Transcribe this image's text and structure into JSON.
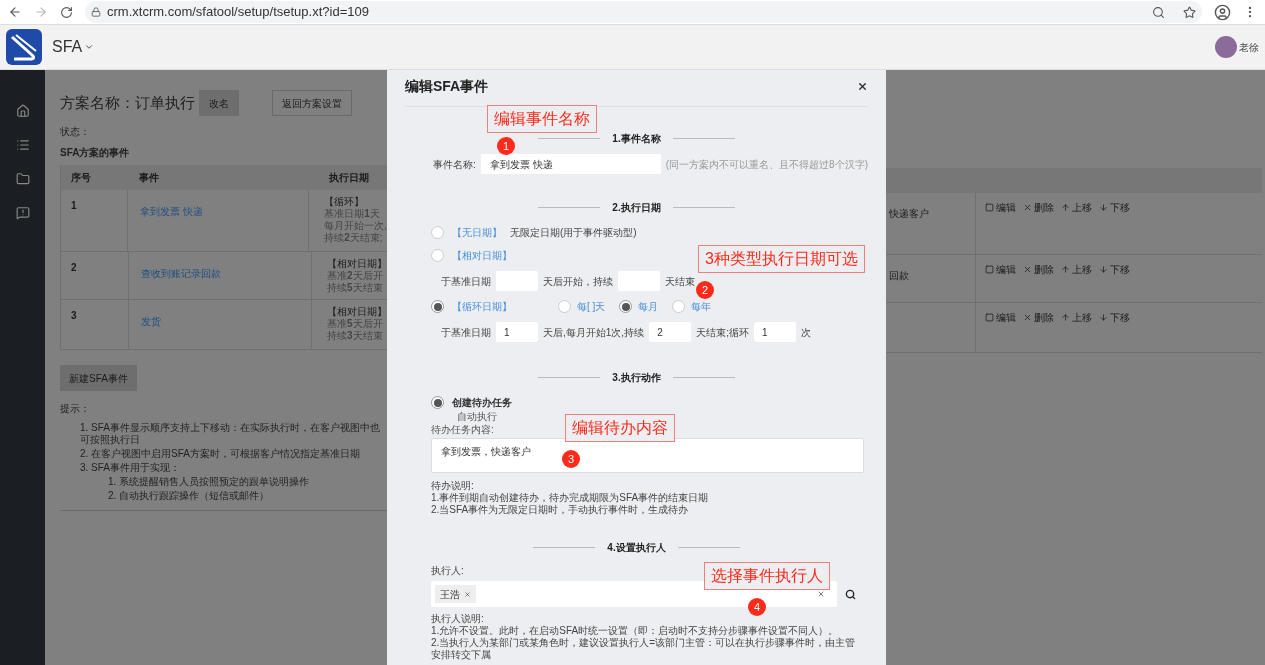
{
  "browser": {
    "url": "crm.xtcrm.com/sfatool/setup/tsetup.xt?id=109"
  },
  "app": {
    "title": "SFA",
    "user": "老徐"
  },
  "page": {
    "plan_label": "方案名称：订单执行",
    "rename_button": "改名",
    "back_button": "返回方案设置",
    "status_label": "状态：",
    "events_title": "SFA方案的事件",
    "table": {
      "columns": [
        "序号",
        "事件",
        "执行日期"
      ],
      "rows": [
        {
          "index": "1",
          "event": "拿到发票 快递",
          "date_lines": [
            "【循环】",
            "基准日期**1**天",
            "每月开始一次,",
            "持续**2**天结束;"
          ],
          "column_4": "快递客户",
          "actions": [
            {
              "kind": "edit",
              "label": "编辑"
            },
            {
              "kind": "delete",
              "label": "删除"
            },
            {
              "kind": "up",
              "label": "上移"
            },
            {
              "kind": "down",
              "label": "下移"
            }
          ]
        },
        {
          "index": "2",
          "event": "查收到账记录回款",
          "date_lines": [
            "【相对日期】",
            "基准**2**天后开",
            "持续**5**天结束"
          ],
          "column_4": "回款",
          "actions": [
            {
              "kind": "edit",
              "label": "编辑"
            },
            {
              "kind": "delete",
              "label": "删除"
            },
            {
              "kind": "up",
              "label": "上移"
            },
            {
              "kind": "down",
              "label": "下移"
            }
          ]
        },
        {
          "index": "3",
          "event": "发货",
          "date_lines": [
            "【相对日期】",
            "基准**5**天后开",
            "持续**3**天结束"
          ],
          "actions": [
            {
              "kind": "edit",
              "label": "编辑"
            },
            {
              "kind": "delete",
              "label": "删除"
            },
            {
              "kind": "up",
              "label": "上移"
            },
            {
              "kind": "down",
              "label": "下移"
            }
          ]
        }
      ]
    },
    "new_button": "新建SFA事件",
    "tips_title": "提示：",
    "tips": [
      {
        "text": "1. SFA事件显示顺序支持上下移动：在实际执行时，在客户视图中也可按照执行日"
      },
      {
        "text": "2. 在客户视图中启用SFA方案时，可根据客户情况指定基准日期"
      },
      {
        "text": "3. SFA事件用于实现：",
        "children": [
          {
            "text": "1. 系统提醒销售人员按照预定的跟单说明操作"
          },
          {
            "text": "2. 自动执行跟踪操作（短信或邮件）"
          }
        ]
      }
    ]
  },
  "modal": {
    "title": "编辑SFA事件",
    "name_section": {
      "heading": "1.事件名称",
      "label": "事件名称:",
      "value": "拿到发票 快递",
      "hint": "(同一方案内不可以重名、且不得超过8个汉字)"
    },
    "date_section": {
      "heading": "2.执行日期",
      "options": [
        {
          "tag": "【无日期】",
          "text": "无限定日期(用于事件驱动型)",
          "selected": false
        },
        {
          "tag": "【相对日期】",
          "selected": false,
          "fields": [
            {
              "kind": "text",
              "text": "于基准日期"
            },
            {
              "kind": "input"
            },
            {
              "kind": "text",
              "text": "天后开始，持续"
            },
            {
              "kind": "input"
            },
            {
              "kind": "text",
              "text": "天结束"
            }
          ]
        },
        {
          "tag": "【循环日期】",
          "selected": true,
          "periods": [
            {
              "label": "每[ ]天",
              "selected": false
            },
            {
              "label": "每月",
              "selected": true
            },
            {
              "label": "每年",
              "selected": false
            }
          ],
          "fields": [
            {
              "kind": "text",
              "text": "于基准日期"
            },
            {
              "kind": "input",
              "value": "1"
            },
            {
              "kind": "text",
              "text": "天后,每月开始1次,持续"
            },
            {
              "kind": "input",
              "value": "2"
            },
            {
              "kind": "text",
              "text": "天结束;循环"
            },
            {
              "kind": "input",
              "value": "1"
            },
            {
              "kind": "text",
              "text": "次"
            }
          ]
        }
      ]
    },
    "action_section": {
      "heading": "3.执行动作",
      "option": {
        "label": "创建待办任务",
        "selected": true
      },
      "sub_label": "自动执行",
      "content_label": "待办任务内容:",
      "content_value": "拿到发票，快递客户",
      "notes_title": "待办说明:",
      "notes": [
        "1.事件到期自动创建待办，待办完成期限为SFA事件的结束日期",
        "2.当SFA事件为无限定日期时，手动执行事件时，生成待办"
      ]
    },
    "executor_section": {
      "heading": "4.设置执行人",
      "label": "执行人:",
      "tags": [
        "王浩"
      ],
      "notes_title": "执行人说明:",
      "notes": [
        "1.允许不设置。此时，在启动SFA时统一设置（即：启动时不支持分步骤事件设置不同人）。",
        "2.当执行人为某部门或某角色时，建议设置执行人=该部门主管：可以在执行步骤事件时，由主管安排转交下属"
      ]
    }
  },
  "annotations": [
    {
      "label": "编辑事件名称",
      "number": "1"
    },
    {
      "label": "3种类型执行日期可选",
      "number": "2"
    },
    {
      "label": "编辑待办内容",
      "number": "3"
    },
    {
      "label": "选择事件执行人",
      "number": "4"
    }
  ]
}
